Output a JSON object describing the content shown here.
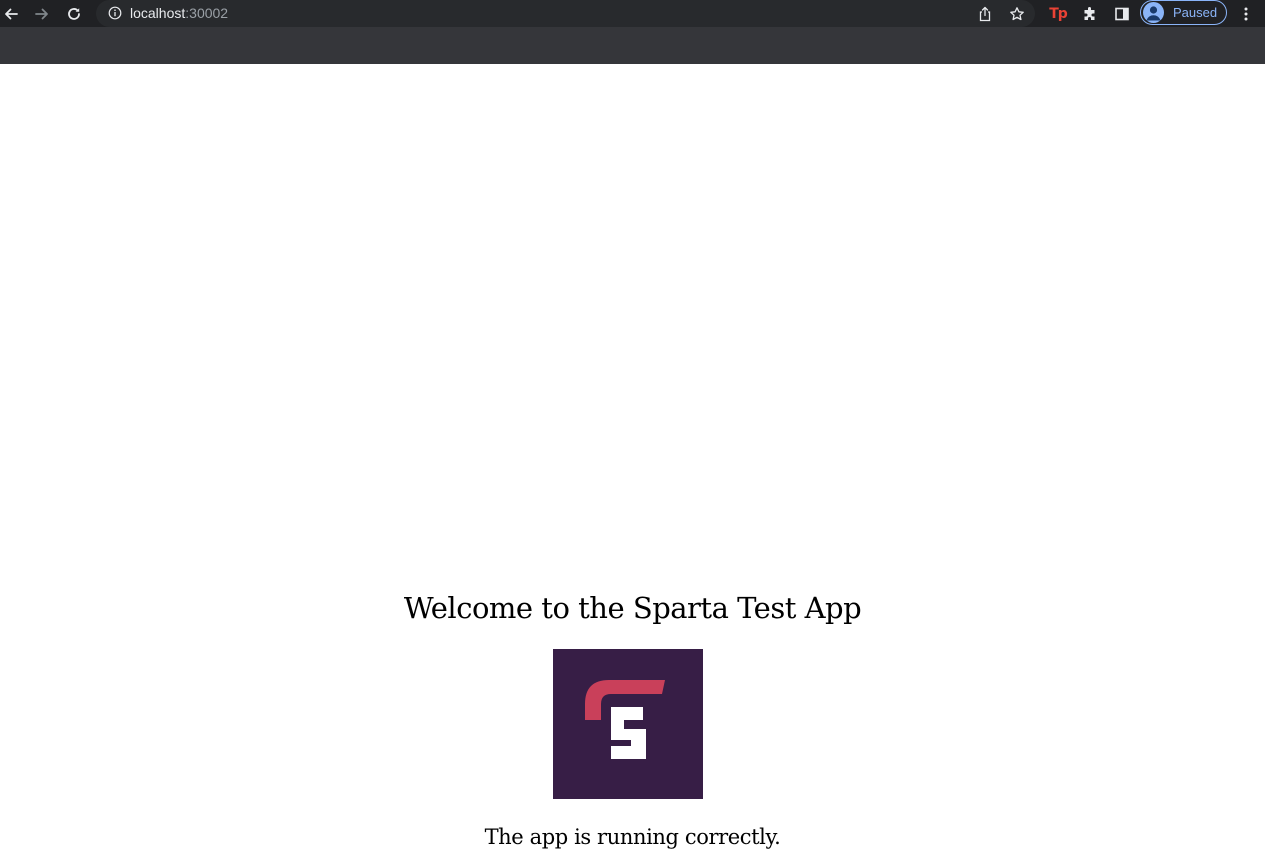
{
  "browser": {
    "url_host": "localhost",
    "url_port": ":30002",
    "profile_status": "Paused",
    "extension_badge": "Tp",
    "icons": {
      "back": "back-arrow-icon",
      "forward": "forward-arrow-icon",
      "reload": "reload-icon",
      "site_info": "info-icon",
      "share": "share-icon",
      "bookmark": "star-icon",
      "extensions": "puzzle-icon",
      "side_panel": "side-panel-icon",
      "menu": "kebab-menu-icon"
    },
    "colors": {
      "toolbar": "#202124",
      "bookmarks_bar": "#35363a",
      "accent": "#8ab4f8",
      "extension_red": "#e94235"
    }
  },
  "page": {
    "title": "Welcome to the Sparta Test App",
    "subtitle": "The app is running correctly.",
    "logo": {
      "name": "sparta-logo",
      "background": "#371e46",
      "accent": "#c9405a",
      "letter_color": "#ffffff"
    }
  }
}
